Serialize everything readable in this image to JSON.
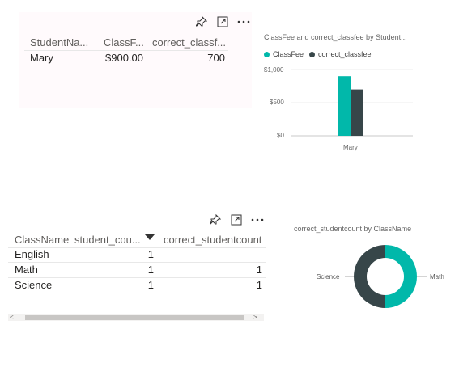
{
  "top_table": {
    "columns": [
      "StudentNa...",
      "ClassF...",
      "correct_classf..."
    ],
    "rows": [
      [
        "Mary",
        "$900.00",
        "700"
      ]
    ]
  },
  "bar_chart": {
    "title": "ClassFee and correct_classfee by Student...",
    "legend": [
      {
        "label": "ClassFee",
        "color": "#01b8aa"
      },
      {
        "label": "correct_classfee",
        "color": "#374649"
      }
    ],
    "y_ticks": [
      "$1,000",
      "$500",
      "$0"
    ],
    "x_label": "Mary"
  },
  "bottom_table": {
    "columns": [
      "ClassName",
      "student_cou...",
      "correct_studentcount"
    ],
    "rows": [
      [
        "English",
        "1",
        ""
      ],
      [
        "Math",
        "1",
        "1"
      ],
      [
        "Science",
        "1",
        "1"
      ]
    ]
  },
  "donut_chart": {
    "title": "correct_studentcount by ClassName",
    "labels": {
      "left": "Science",
      "right": "Math"
    }
  },
  "chart_data": [
    {
      "type": "bar",
      "title": "ClassFee and correct_classfee by Student...",
      "categories": [
        "Mary"
      ],
      "series": [
        {
          "name": "ClassFee",
          "values": [
            900
          ]
        },
        {
          "name": "correct_classfee",
          "values": [
            700
          ]
        }
      ],
      "ylim": [
        0,
        1000
      ],
      "y_tick_labels": [
        "$0",
        "$500",
        "$1,000"
      ],
      "legend": "top-left",
      "grid": true
    },
    {
      "type": "pie",
      "title": "correct_studentcount by ClassName",
      "categories": [
        "Math",
        "Science"
      ],
      "values": [
        1,
        1
      ]
    }
  ],
  "colors": {
    "accent": "#01b8aa",
    "dark": "#374649"
  }
}
